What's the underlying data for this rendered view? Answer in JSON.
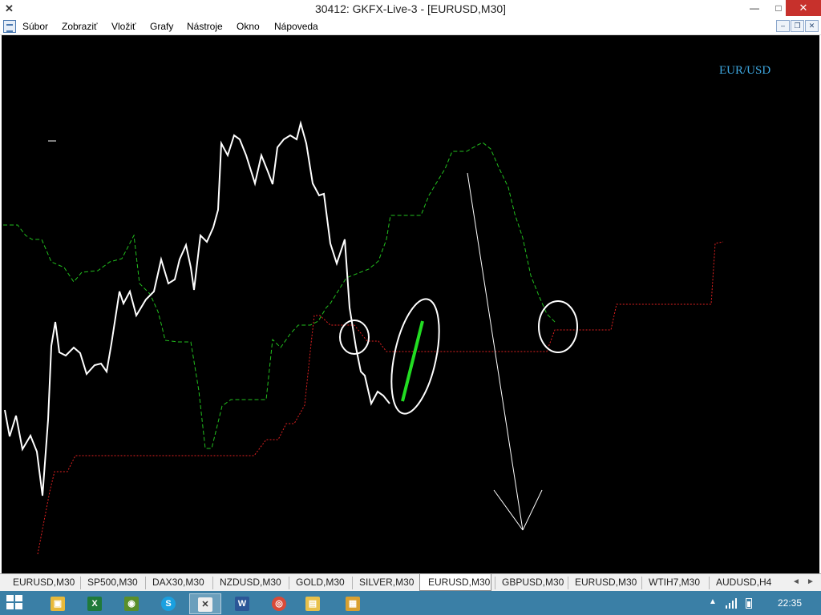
{
  "window": {
    "title": "30412: GKFX-Live-3 - [EURUSD,M30]",
    "minimize_glyph": "—",
    "maximize_glyph": "□",
    "close_glyph": "✕",
    "app_icon": "metatrader-x-icon"
  },
  "menu": {
    "items": [
      {
        "label": "Súbor"
      },
      {
        "label": "Zobraziť"
      },
      {
        "label": "Vložiť"
      },
      {
        "label": "Grafy"
      },
      {
        "label": "Nástroje"
      },
      {
        "label": "Okno"
      },
      {
        "label": "Nápoveda"
      }
    ],
    "mdi_controls": {
      "minimize": "–",
      "restore": "❐",
      "close": "✕"
    }
  },
  "chart": {
    "symbol_label": "EUR/USD",
    "background": "#000000",
    "colors": {
      "price": "#ffffff",
      "span": "#22c01e",
      "kijun": "#e02020",
      "annotation": "#ffffff",
      "trend_highlight": "#22dd22",
      "symbol": "#3ea7e0"
    },
    "annotations": [
      "circle",
      "ellipse-with-green-line",
      "circle",
      "down-arrow"
    ]
  },
  "tabs": {
    "items": [
      {
        "label": "EURUSD,M30",
        "active": false
      },
      {
        "label": "SP500,M30",
        "active": false
      },
      {
        "label": "DAX30,M30",
        "active": false
      },
      {
        "label": "NZDUSD,M30",
        "active": false
      },
      {
        "label": "GOLD,M30",
        "active": false
      },
      {
        "label": "SILVER,M30",
        "active": false
      },
      {
        "label": "EURUSD,M30",
        "active": true
      },
      {
        "label": "GBPUSD,M30",
        "active": false
      },
      {
        "label": "EURUSD,M30",
        "active": false
      },
      {
        "label": "WTIH7,M30",
        "active": false
      },
      {
        "label": "AUDUSD,H4",
        "active": false
      }
    ],
    "scroll_left": "◄",
    "scroll_right": "►"
  },
  "taskbar": {
    "apps": [
      {
        "name": "explorer-photos-icon",
        "glyph": "▣",
        "color": "#e8b93a"
      },
      {
        "name": "excel-icon",
        "glyph": "X",
        "color": "#1f7a3a"
      },
      {
        "name": "globe-app-icon",
        "glyph": "◉",
        "color": "#5a8f2a"
      },
      {
        "name": "skype-icon",
        "glyph": "S",
        "color": "#1aa0e0"
      },
      {
        "name": "metatrader-icon",
        "glyph": "✕",
        "color": "#444444"
      },
      {
        "name": "word-icon",
        "glyph": "W",
        "color": "#2b5797"
      },
      {
        "name": "chrome-icon",
        "glyph": "◎",
        "color": "#d94a38"
      },
      {
        "name": "file-explorer-icon",
        "glyph": "▤",
        "color": "#e8c04a"
      },
      {
        "name": "media-icon",
        "glyph": "▦",
        "color": "#d9a030"
      }
    ],
    "tray_arrow": "▲",
    "clock": "22:35"
  }
}
